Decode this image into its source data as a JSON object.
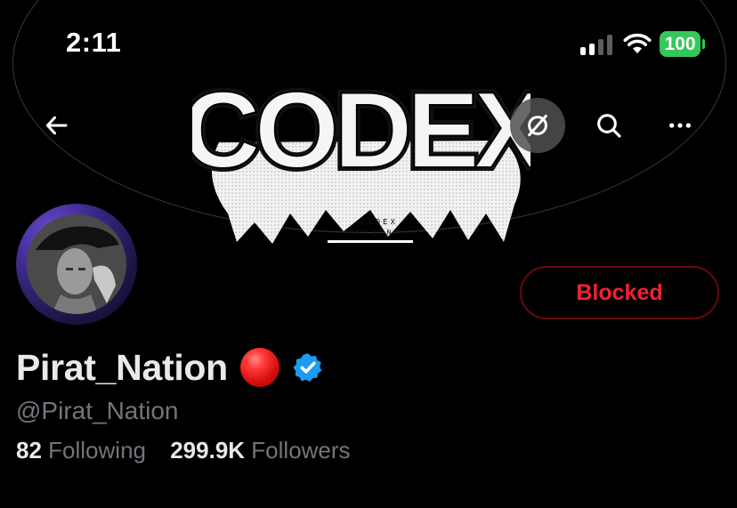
{
  "status_bar": {
    "time": "2:11",
    "battery_level": "100",
    "signal_bars_active": 2,
    "signal_bars_total": 4,
    "colors": {
      "battery": "#34c759"
    }
  },
  "banner": {
    "logo_text": "CODEX",
    "logo_subtext_line1": "CODEX",
    "logo_subtext_line2": "PRESENTS"
  },
  "nav": {
    "back_icon": "arrow-left-icon",
    "grok_icon": "grok-slash-circle-icon",
    "search_icon": "search-icon",
    "more_icon": "more-horizontal-icon"
  },
  "profile": {
    "display_name": "Pirat_Nation",
    "handle": "@Pirat_Nation",
    "emoji": "red-circle",
    "verified": true,
    "following_count": "82",
    "following_label": "Following",
    "followers_count": "299.9K",
    "followers_label": "Followers"
  },
  "actions": {
    "blocked_label": "Blocked"
  },
  "colors": {
    "background": "#000000",
    "primary_text": "#e7e9ea",
    "secondary_text": "#71767b",
    "blocked_red": "#f4212e",
    "blocked_border": "#67070f",
    "verified_blue": "#1d9bf0"
  }
}
